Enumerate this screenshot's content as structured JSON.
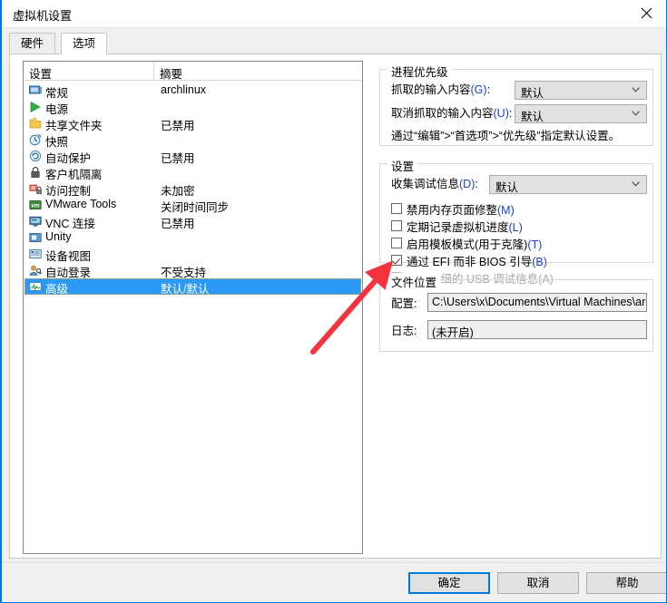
{
  "window": {
    "title": "虚拟机设置",
    "close_label": "×"
  },
  "tabs": [
    {
      "label": "硬件",
      "active": false
    },
    {
      "label": "选项",
      "active": true
    }
  ],
  "list": {
    "headers": {
      "setting": "设置",
      "summary": "摘要"
    },
    "rows": [
      {
        "label": "常规",
        "summary": "archlinux",
        "icon": "monitor-icon",
        "selected": false
      },
      {
        "label": "电源",
        "summary": "",
        "icon": "play-icon",
        "selected": false
      },
      {
        "label": "共享文件夹",
        "summary": "已禁用",
        "icon": "folder-icon",
        "selected": false
      },
      {
        "label": "快照",
        "summary": "",
        "icon": "snapshot-icon",
        "selected": false
      },
      {
        "label": "自动保护",
        "summary": "已禁用",
        "icon": "autoprotect-icon",
        "selected": false
      },
      {
        "label": "客户机隔离",
        "summary": "",
        "icon": "lock-icon",
        "selected": false
      },
      {
        "label": "访问控制",
        "summary": "未加密",
        "icon": "access-icon",
        "selected": false
      },
      {
        "label": "VMware Tools",
        "summary": "关闭时间同步",
        "icon": "vmware-tools-icon",
        "selected": false
      },
      {
        "label": "VNC 连接",
        "summary": "已禁用",
        "icon": "vnc-icon",
        "selected": false
      },
      {
        "label": "Unity",
        "summary": "",
        "icon": "unity-icon",
        "selected": false
      },
      {
        "label": "设备视图",
        "summary": "",
        "icon": "device-view-icon",
        "selected": false
      },
      {
        "label": "自动登录",
        "summary": "不受支持",
        "icon": "autologon-icon",
        "selected": false
      },
      {
        "label": "高级",
        "summary": "默认/默认",
        "icon": "advanced-icon",
        "selected": true
      }
    ]
  },
  "priority": {
    "legend": "进程优先级",
    "grab_label": "抓取的输入内容(G):",
    "grab_value": "默认",
    "ungrab_label": "取消抓取的输入内容(U):",
    "ungrab_value": "默认",
    "note": "通过“编辑”>“首选项”>“优先级”指定默认设置。"
  },
  "settings": {
    "legend": "设置",
    "debug_label": "收集调试信息(D):",
    "debug_value": "默认",
    "checkboxes": [
      {
        "label": "禁用内存页面修整(M)",
        "checked": false,
        "disabled": false
      },
      {
        "label": "定期记录虚拟机进度(L)",
        "checked": false,
        "disabled": false
      },
      {
        "label": "启用模板模式(用于克隆)(T)",
        "checked": false,
        "disabled": false
      },
      {
        "label": "通过 EFI 而非 BIOS 引导(B)",
        "checked": true,
        "disabled": false
      },
      {
        "label": "收集详细的 USB 调试信息(A)",
        "checked": false,
        "disabled": true
      }
    ]
  },
  "files": {
    "legend": "文件位置",
    "config_label": "配置:",
    "config_value": "C:\\Users\\x\\Documents\\Virtual Machines\\arc",
    "log_label": "日志:",
    "log_value": "(未开启)"
  },
  "footer": {
    "ok": "确定",
    "cancel": "取消",
    "help": "帮助"
  },
  "colors": {
    "accent": "#0078d7",
    "selection": "#2a9af6",
    "annotation": "#f5333f"
  }
}
